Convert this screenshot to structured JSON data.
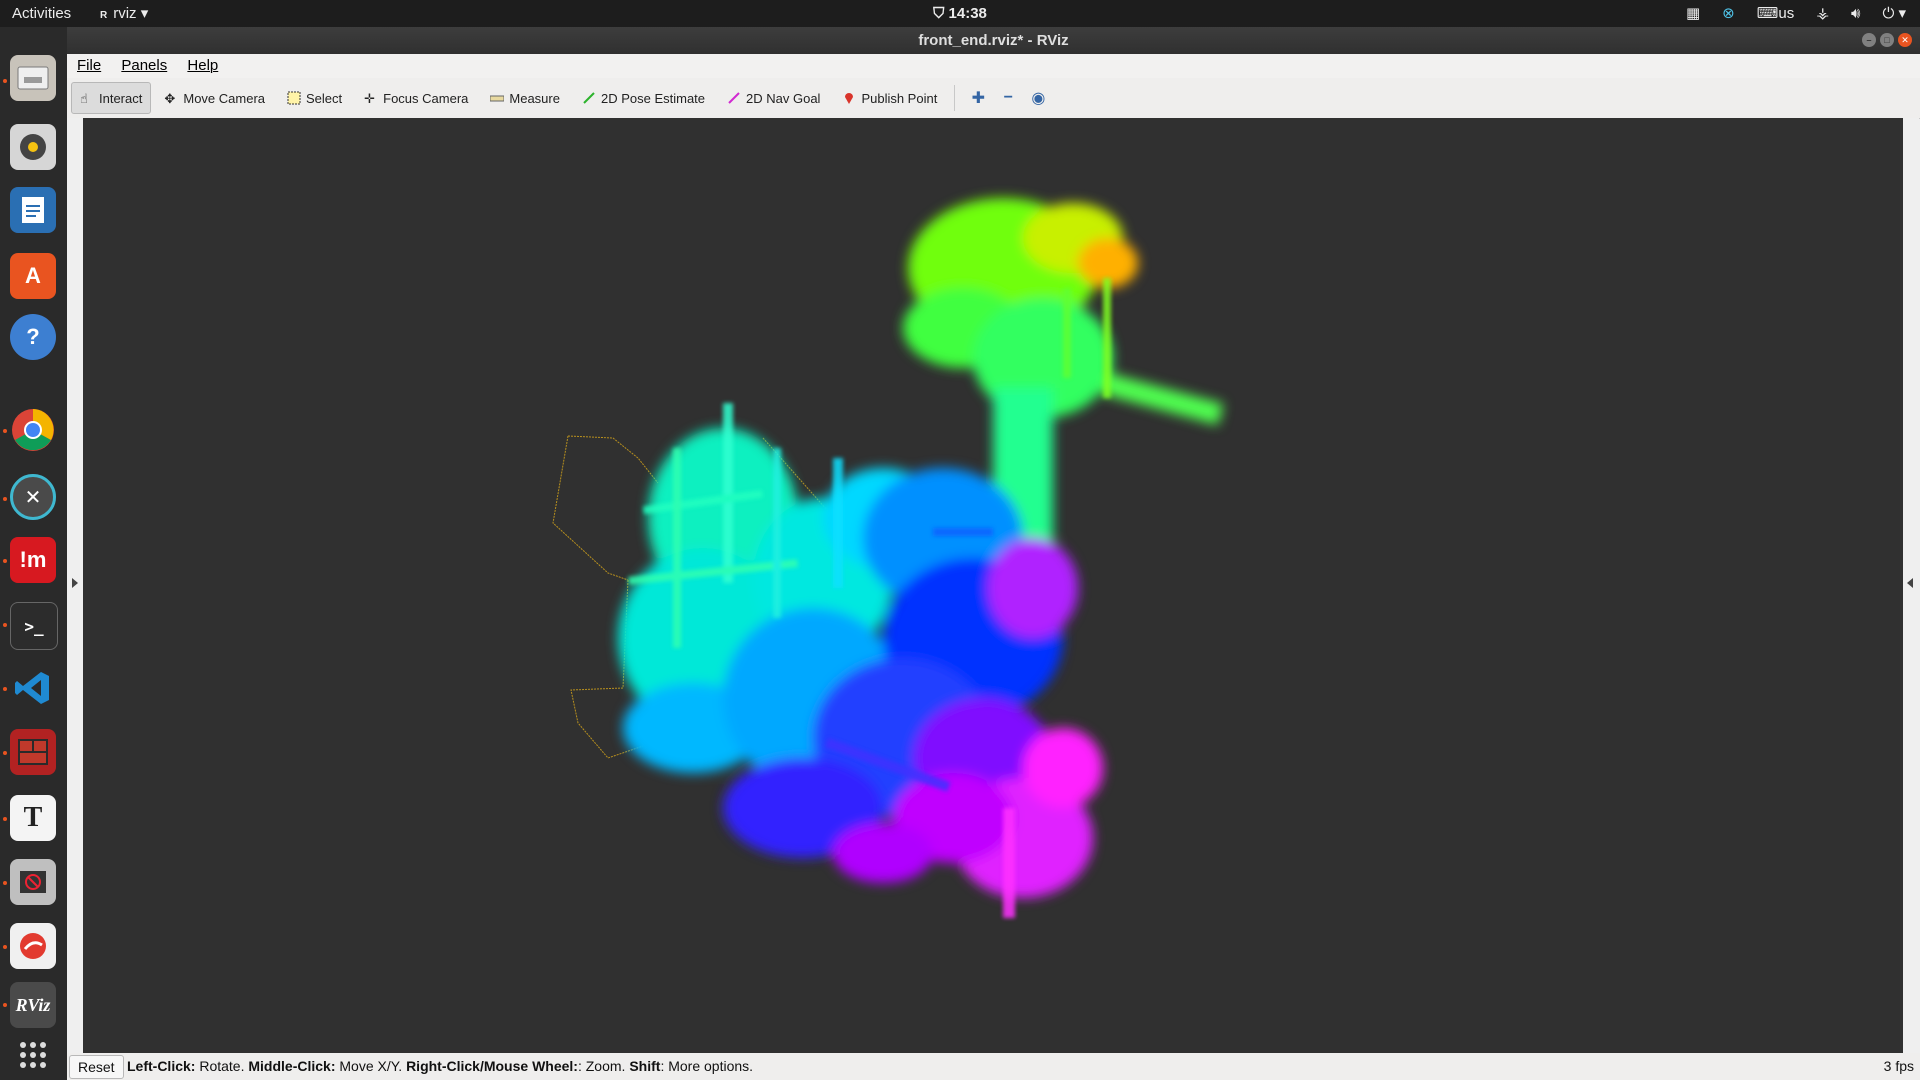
{
  "topbar": {
    "activities": "Activities",
    "app_name": "rviz",
    "app_badge": "RViz",
    "clock": "14:38",
    "keyboard_layout": "us"
  },
  "window": {
    "title": "front_end.rviz* - RViz"
  },
  "menubar": {
    "file": "File",
    "panels": "Panels",
    "help": "Help"
  },
  "toolbar": {
    "interact": "Interact",
    "move_camera": "Move Camera",
    "select": "Select",
    "focus_camera": "Focus Camera",
    "measure": "Measure",
    "pose_estimate": "2D Pose Estimate",
    "nav_goal": "2D Nav Goal",
    "publish_point": "Publish Point"
  },
  "dock": {
    "items": [
      "files",
      "rhythmbox",
      "writer",
      "software",
      "help",
      "chrome",
      "xmind",
      "mendeley",
      "terminal",
      "vscode",
      "terminator",
      "typora",
      "blocker",
      "wps",
      "rviz",
      "apps"
    ],
    "rviz_badge": "RViz",
    "typora_badge": "T"
  },
  "statusbar": {
    "reset": "Reset",
    "hint": {
      "left_click_key": "Left-Click:",
      "left_click_action": " Rotate. ",
      "middle_click_key": "Middle-Click:",
      "middle_click_action": " Move X/Y. ",
      "right_click_key": "Right-Click/Mouse Wheel:",
      "right_click_action": ": Zoom. ",
      "shift_key": "Shift",
      "shift_action": ": More options."
    },
    "fps": "3 fps"
  },
  "colors": {
    "accent": "#e95420",
    "render_bg": "#303030",
    "cloud_hues": [
      "#a0ff00",
      "#00ffb0",
      "#00c8ff",
      "#0040ff",
      "#ff00ff"
    ]
  }
}
